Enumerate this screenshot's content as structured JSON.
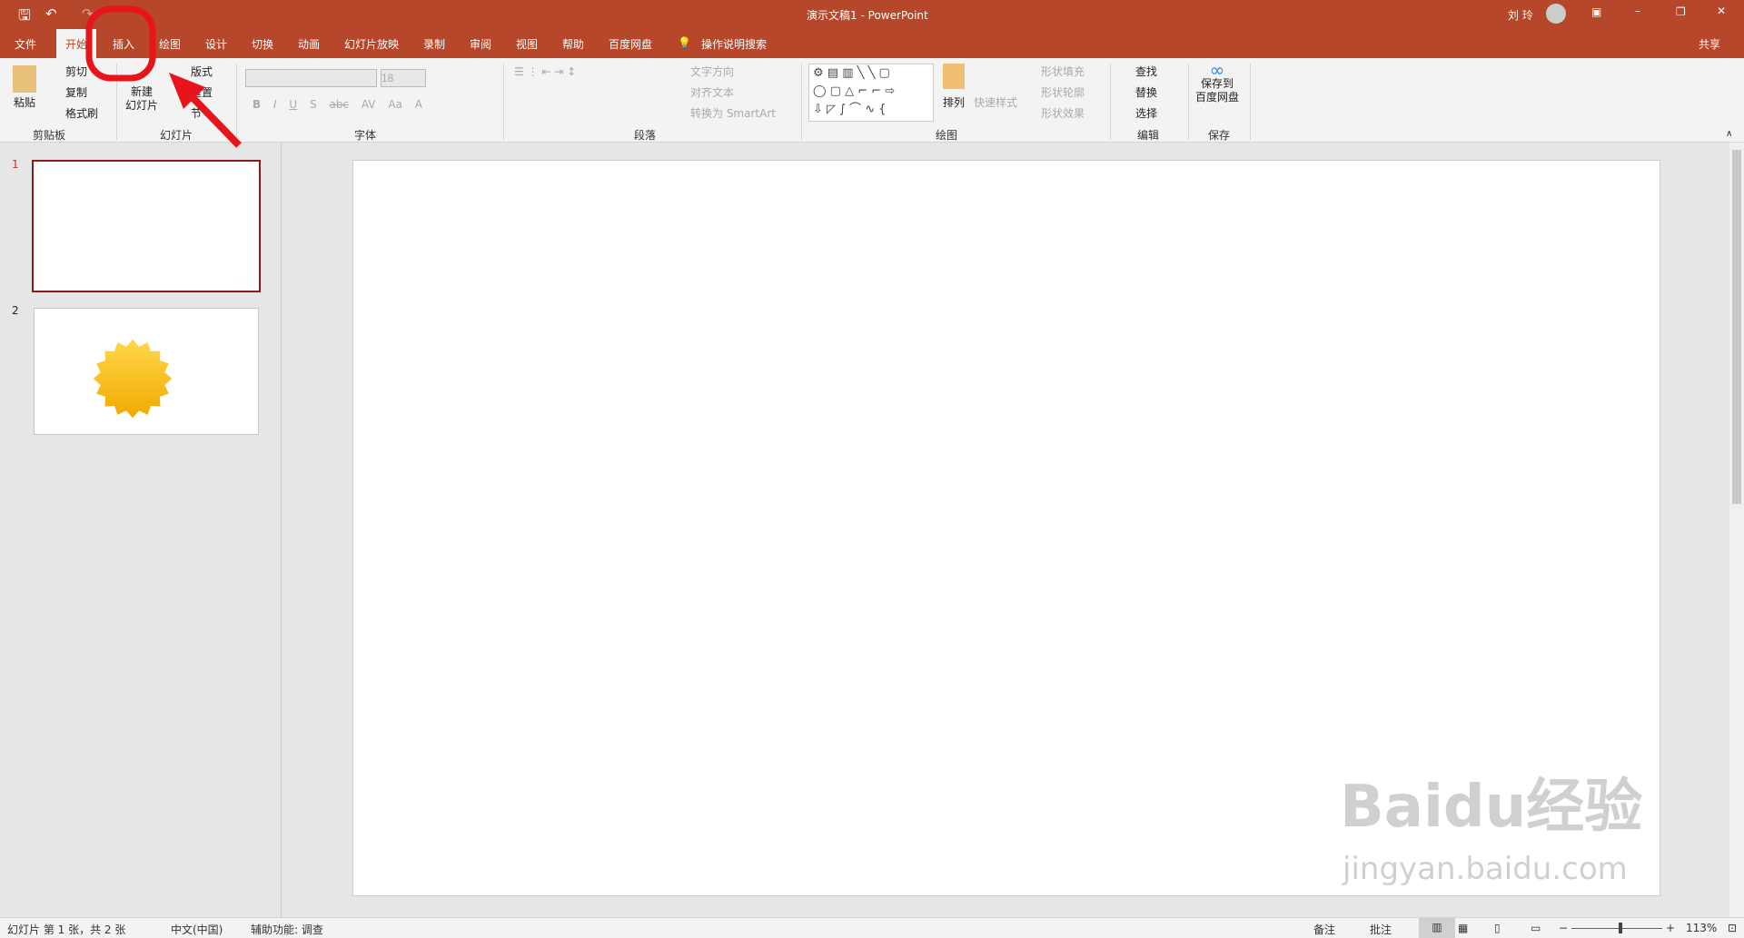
{
  "title": {
    "document": "演示文稿1",
    "separator": "-",
    "app": "PowerPoint",
    "user": "刘 玲",
    "share": "共享"
  },
  "tabs": [
    "文件",
    "开始",
    "插入",
    "绘图",
    "设计",
    "切换",
    "动画",
    "幻灯片放映",
    "录制",
    "审阅",
    "视图",
    "帮助",
    "百度网盘"
  ],
  "active_tab": "开始",
  "tell_me": "操作说明搜索",
  "ribbon": {
    "clipboard": {
      "paste": "粘贴",
      "cut": "剪切",
      "copy": "复制",
      "format_painter": "格式刷",
      "label": "剪贴板"
    },
    "slides": {
      "new_slide_1": "新建",
      "new_slide_2": "幻灯片",
      "layout": "版式",
      "reset": "重置",
      "section": "节",
      "label": "幻灯片"
    },
    "font": {
      "font_name": "",
      "font_size": "18",
      "label": "字体",
      "bold": "B",
      "italic": "I",
      "underline": "U",
      "shadow": "S",
      "strike": "abc",
      "spacing": "AV",
      "case": "Aa",
      "color": "A"
    },
    "paragraph": {
      "text_direction": "文字方向",
      "align_text": "对齐文本",
      "smartart": "转换为 SmartArt",
      "label": "段落"
    },
    "drawing": {
      "arrange": "排列",
      "quick_styles": "快速样式",
      "shape_fill": "形状填充",
      "shape_outline": "形状轮廓",
      "shape_effects": "形状效果",
      "label": "绘图"
    },
    "editing": {
      "find": "查找",
      "replace": "替换",
      "select": "选择",
      "label": "编辑"
    },
    "save": {
      "save_1": "保存到",
      "save_2": "百度网盘",
      "label": "保存"
    }
  },
  "slides": [
    {
      "number": "1",
      "selected": true
    },
    {
      "number": "2",
      "content": "sun-shape"
    }
  ],
  "status": {
    "slide_info": "幻灯片 第 1 张，共 2 张",
    "language": "中文(中国)",
    "accessibility": "辅助功能: 调查",
    "notes": "备注",
    "comments": "批注",
    "zoom": "113%",
    "zoom_minus": "−",
    "zoom_plus": "+"
  },
  "watermark": {
    "logo": "Baidu经验",
    "url": "jingyan.baidu.com"
  },
  "colors": {
    "accent": "#b7472a",
    "annotation": "#e8141c",
    "selected_border": "#8b1a1a"
  }
}
